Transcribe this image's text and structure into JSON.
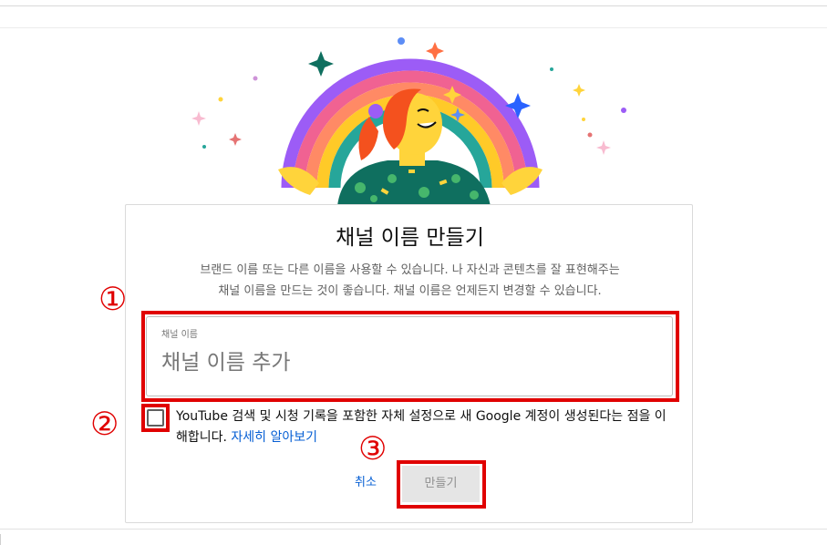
{
  "dialog": {
    "title": "채널 이름 만들기",
    "description_line1": "브랜드 이름 또는 다른 이름을 사용할 수 있습니다. 나 자신과 콘텐츠를 잘 표현해주는",
    "description_line2": "채널 이름을 만드는 것이 좋습니다. 채널 이름은 언제든지 변경할 수 있습니다."
  },
  "field": {
    "label": "채널 이름",
    "value": "",
    "placeholder": "채널 이름 추가"
  },
  "consent": {
    "text": "YouTube 검색 및 시청 기록을 포함한 자체 설정으로 새 Google 계정이 생성된다는 점을 이해합니다. ",
    "link": "자세히 알아보기",
    "checked": false
  },
  "actions": {
    "cancel": "취소",
    "create": "만들기"
  },
  "annotations": {
    "n1": "①",
    "n2": "②",
    "n3": "③",
    "color": "#e00000"
  },
  "colors": {
    "link": "#065fd4",
    "disabled_button_bg": "#e5e5e5"
  }
}
